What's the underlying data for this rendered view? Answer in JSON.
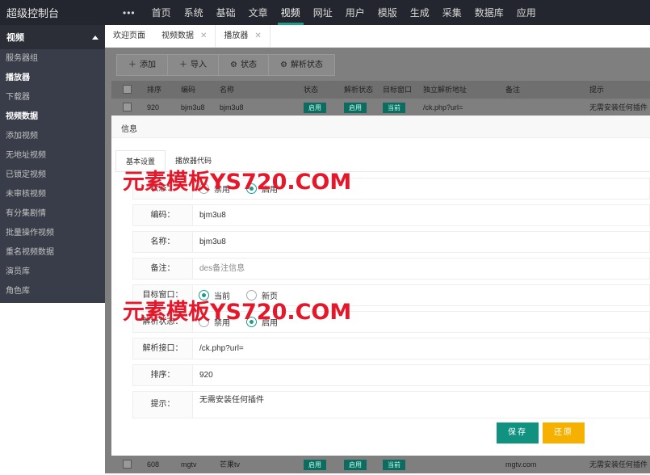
{
  "app": {
    "title": "超级控制台"
  },
  "topnav": {
    "items": [
      "首页",
      "系统",
      "基础",
      "文章",
      "视频",
      "网址",
      "用户",
      "模版",
      "生成",
      "采集",
      "数据库",
      "应用"
    ],
    "active_index": 4
  },
  "sidebar": {
    "header": "视频",
    "items": [
      "服务器组",
      "播放器",
      "下载器",
      "视频数据",
      "添加视频",
      "无地址视频",
      "已锁定视频",
      "未审核视频",
      "有分集剧情",
      "批量操作视频",
      "重名视频数据",
      "演员库",
      "角色库"
    ],
    "bold_indexes": [
      1,
      3
    ]
  },
  "tabs": [
    {
      "label": "欢迎页面",
      "closable": false
    },
    {
      "label": "视频数据",
      "closable": true
    },
    {
      "label": "播放器",
      "closable": true,
      "active": true
    }
  ],
  "toolbar": {
    "add": "添加",
    "import": "导入",
    "status": "状态",
    "parse_status": "解析状态"
  },
  "table": {
    "headers": [
      "排序",
      "编码",
      "名称",
      "状态",
      "解析状态",
      "目标窗口",
      "独立解析地址",
      "备注",
      "提示"
    ],
    "rows": [
      {
        "sort": "920",
        "code": "bjm3u8",
        "name": "bjm3u8",
        "status": "启用",
        "parse": "启用",
        "target": "当前",
        "url": "/ck.php?url=",
        "note": "",
        "tip": "无需安装任何插件"
      },
      {
        "sort": "608",
        "code": "mgtv",
        "name": "芒果tv",
        "status": "启用",
        "parse": "启用",
        "target": "当前",
        "url": "",
        "note": "mgtv.com",
        "tip": "无需安装任何插件"
      }
    ]
  },
  "modal": {
    "title": "信息",
    "tabs": [
      "基本设置",
      "播放器代码"
    ],
    "fields": {
      "status_label": "状态：",
      "status_options": [
        "禁用",
        "启用"
      ],
      "code_label": "编码：",
      "code_value": "bjm3u8",
      "name_label": "名称：",
      "name_value": "bjm3u8",
      "note_label": "备注：",
      "note_placeholder": "des备注信息",
      "target_label": "目标窗口：",
      "target_options": [
        "当前",
        "新页"
      ],
      "parse_status_label": "解析状态：",
      "parse_status_options": [
        "禁用",
        "启用"
      ],
      "parse_api_label": "解析接口：",
      "parse_api_value": "/ck.php?url=",
      "sort_label": "排序：",
      "sort_value": "920",
      "tip_label": "提示：",
      "tip_value": "无需安装任何插件"
    },
    "save": "保存",
    "reset": "还原"
  },
  "watermark": "元素模板YS720.COM",
  "colors": {
    "accent": "#1e9b8a",
    "save": "#11917f",
    "reset": "#f6b000",
    "watermark": "#e4182a"
  }
}
